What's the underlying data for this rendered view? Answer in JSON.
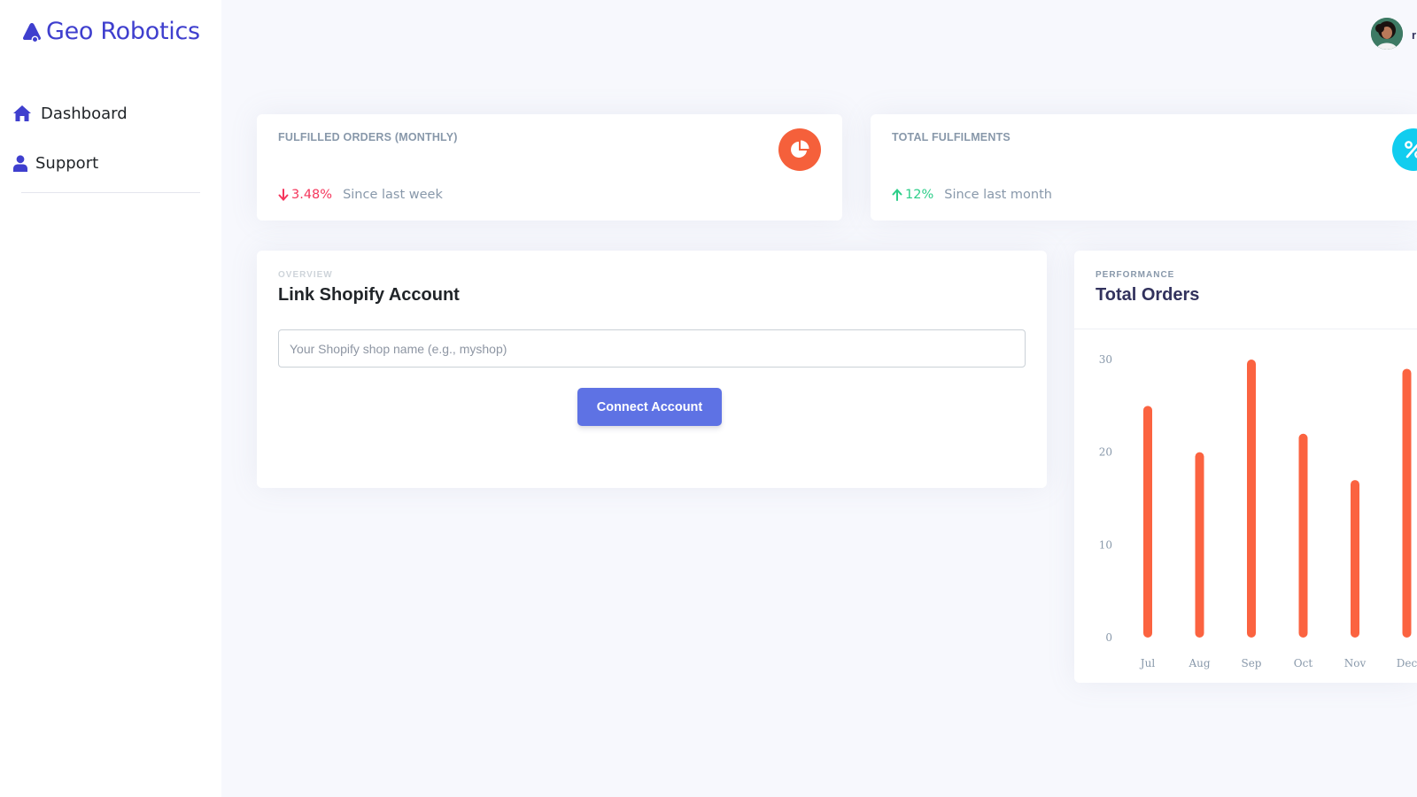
{
  "app": {
    "brand": "Geo Robotics",
    "brand_color": "#3f3fce"
  },
  "sidebar": {
    "items": [
      {
        "label": "Dashboard",
        "icon": "home-icon"
      },
      {
        "label": "Support",
        "icon": "user-icon"
      }
    ]
  },
  "user": {
    "initial": "r"
  },
  "stats": [
    {
      "title": "FULFILLED ORDERS (MONTHLY)",
      "icon": "pie-chart-icon",
      "icon_color": "#f5603b",
      "delta": "3.48%",
      "delta_direction": "down",
      "delta_color": "#f5365c",
      "since": "Since last week"
    },
    {
      "title": "TOTAL FULFILMENTS",
      "icon": "percent-icon",
      "icon_color": "#11cdef",
      "delta": "12%",
      "delta_direction": "up",
      "delta_color": "#2dce89",
      "since": "Since last month"
    }
  ],
  "overview": {
    "eyebrow": "OVERVIEW",
    "title": "Link Shopify Account",
    "input_placeholder": "Your Shopify shop name (e.g., myshop)",
    "input_value": "",
    "button_label": "Connect Account"
  },
  "performance": {
    "eyebrow": "PERFORMANCE",
    "title": "Total Orders"
  },
  "chart_data": {
    "type": "bar",
    "title": "Total Orders",
    "categories": [
      "Jul",
      "Aug",
      "Sep",
      "Oct",
      "Nov",
      "Dec"
    ],
    "values": [
      25,
      20,
      30,
      22,
      17,
      29
    ],
    "yticks": [
      0,
      10,
      20,
      30
    ],
    "ylim": [
      0,
      30
    ],
    "xlabel": "",
    "ylabel": "",
    "grid": false,
    "bar_color": "#fb6340"
  }
}
